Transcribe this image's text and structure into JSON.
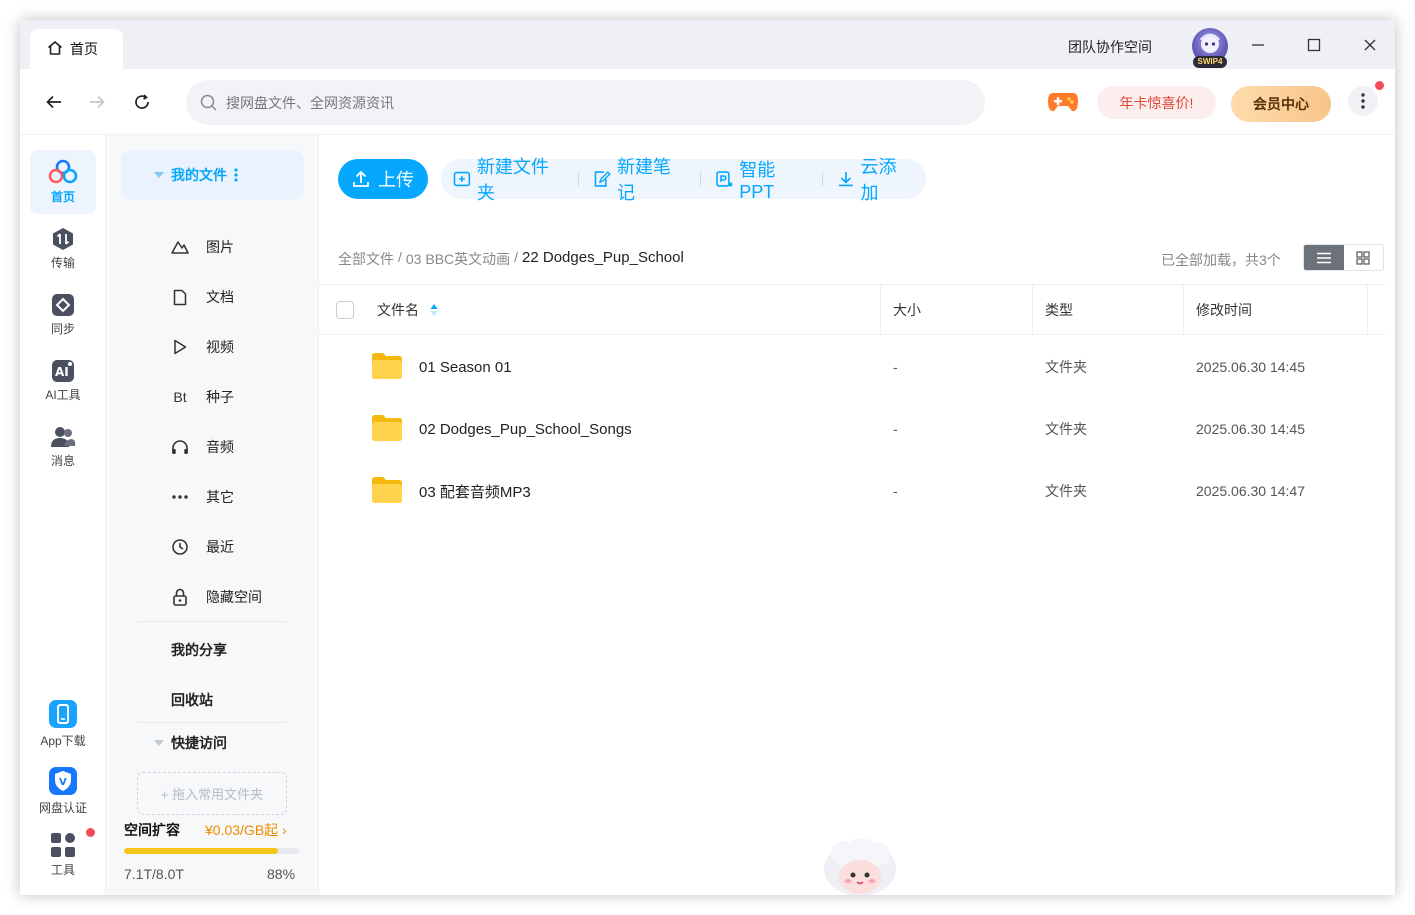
{
  "titlebar": {
    "tab_label": "首页",
    "team_space": "团队协作空间",
    "avatar_badge": "SWIP4"
  },
  "navbar": {
    "search_placeholder": "搜网盘文件、全网资源资讯",
    "promo_label": "年卡惊喜价!",
    "vip_label": "会员中心"
  },
  "rail": {
    "items": [
      {
        "label": "首页",
        "icon": "home-cloud-icon"
      },
      {
        "label": "传输",
        "icon": "transfer-icon"
      },
      {
        "label": "同步",
        "icon": "sync-icon"
      },
      {
        "label": "AI工具",
        "icon": "ai-tools-icon"
      },
      {
        "label": "消息",
        "icon": "message-icon"
      }
    ],
    "bottom": [
      {
        "label": "App下载",
        "icon": "phone-icon"
      },
      {
        "label": "网盘认证",
        "icon": "shield-verified-icon"
      },
      {
        "label": "工具",
        "icon": "grid-tools-icon"
      }
    ]
  },
  "sidebar": {
    "my_files": "我的文件",
    "categories": [
      {
        "label": "图片",
        "icon": "image-icon"
      },
      {
        "label": "文档",
        "icon": "document-icon"
      },
      {
        "label": "视频",
        "icon": "play-icon"
      },
      {
        "label": "种子",
        "icon": "bt-icon",
        "glyph": "Bt"
      },
      {
        "label": "音频",
        "icon": "headphones-icon"
      },
      {
        "label": "其它",
        "icon": "dots-icon"
      },
      {
        "label": "最近",
        "icon": "clock-icon"
      },
      {
        "label": "隐藏空间",
        "icon": "lock-icon"
      }
    ],
    "my_share": "我的分享",
    "recycle_bin": "回收站",
    "quick_access": "快捷访问",
    "drop_hint": "+ 拖入常用文件夹",
    "space_title": "空间扩容",
    "space_price": "¥0.03/GB起 ›",
    "space_used": "7.1T/8.0T",
    "space_percent_label": "88%",
    "space_fraction": 0.88
  },
  "toolbar": {
    "upload": "上传",
    "new_folder": "新建文件夹",
    "new_note": "新建笔记",
    "smart_ppt": "智能PPT",
    "cloud_add": "云添加"
  },
  "breadcrumb": {
    "root": "全部文件",
    "sep": "/",
    "level1": "03 BBC英文动画",
    "current": "22 Dodges_Pup_School"
  },
  "status": {
    "loaded": "已全部加载，共3个"
  },
  "table": {
    "headers": {
      "name": "文件名",
      "size": "大小",
      "type": "类型",
      "modified": "修改时间"
    },
    "rows": [
      {
        "name": "01 Season 01",
        "size": "-",
        "type": "文件夹",
        "modified": "2025.06.30 14:45"
      },
      {
        "name": "02 Dodges_Pup_School_Songs",
        "size": "-",
        "type": "文件夹",
        "modified": "2025.06.30 14:45"
      },
      {
        "name": "03 配套音频MP3",
        "size": "-",
        "type": "文件夹",
        "modified": "2025.06.30 14:47"
      }
    ]
  },
  "colors": {
    "accent": "#06a7ff",
    "promo_text": "#e0483a",
    "storage_bar": "#f5c518",
    "badge_red": "#f54a5a"
  }
}
